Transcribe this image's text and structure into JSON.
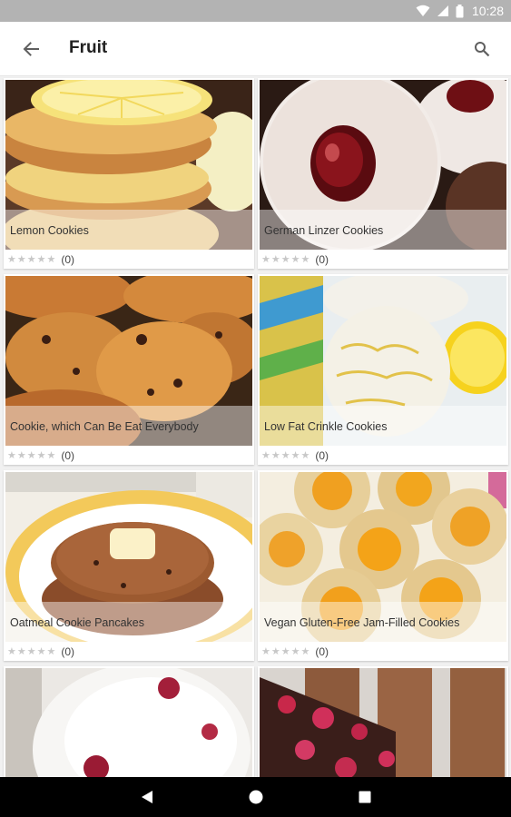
{
  "status_bar": {
    "time": "10:28",
    "icons": [
      "wifi-icon",
      "signal-icon",
      "battery-icon"
    ]
  },
  "app_bar": {
    "title": "Fruit",
    "back_icon": "arrow-left-icon",
    "search_icon": "search-icon"
  },
  "recipes": [
    {
      "name": "Lemon Cookies",
      "rating_count": "(0)",
      "stars": 0
    },
    {
      "name": "German Linzer Cookies",
      "rating_count": "(0)",
      "stars": 0
    },
    {
      "name": "Cookie, which Can Be Eat Everybody",
      "rating_count": "(0)",
      "stars": 0
    },
    {
      "name": "Low Fat Crinkle Cookies",
      "rating_count": "(0)",
      "stars": 0
    },
    {
      "name": "Oatmeal Cookie Pancakes",
      "rating_count": "(0)",
      "stars": 0
    },
    {
      "name": "Vegan Gluten-Free Jam-Filled Cookies",
      "rating_count": "(0)",
      "stars": 0
    },
    {
      "name": "",
      "rating_count": "",
      "stars": 0
    },
    {
      "name": "",
      "rating_count": "",
      "stars": 0
    }
  ],
  "navigation": {
    "back": "nav-back-icon",
    "home": "nav-home-icon",
    "recents": "nav-recents-icon"
  },
  "colors": {
    "status_bar": "#b3b3b3",
    "app_bar": "#ffffff",
    "grid_background": "#f1f1f1",
    "star_empty": "#c8c8c8",
    "nav_bar": "#000000"
  }
}
